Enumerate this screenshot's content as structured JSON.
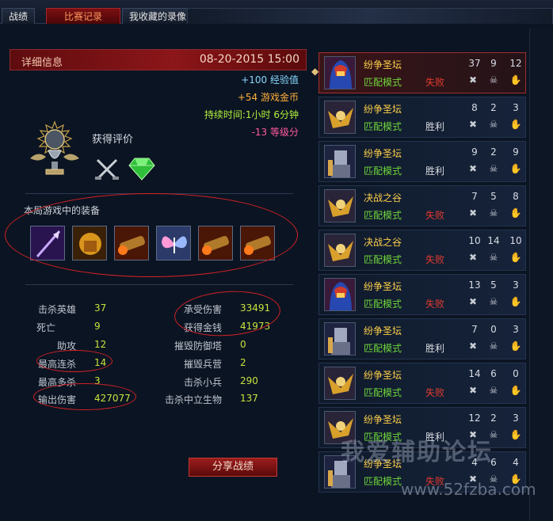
{
  "tabs": [
    {
      "label": "战绩",
      "active": false
    },
    {
      "label": "比赛记录",
      "active": true
    },
    {
      "label": "我收藏的录像",
      "active": false
    }
  ],
  "detail": {
    "title": "详细信息",
    "date": "08-20-2015 15:00",
    "exp": "+100 经验值",
    "gold": "+54 游戏金币",
    "duration": "持续时间:1小时 6分钟",
    "level_points": "-13 等级分",
    "rating_label": "获得评价",
    "equip_title": "本局游戏中的装备",
    "share_button": "分享战绩"
  },
  "stats_left": [
    {
      "label": "击杀英雄",
      "value": "37"
    },
    {
      "label": "死亡",
      "value": "9"
    },
    {
      "label": "助攻",
      "value": "12"
    },
    {
      "label": "最高连杀",
      "value": "14"
    },
    {
      "label": "最高多杀",
      "value": "3"
    },
    {
      "label": "输出伤害",
      "value": "427077"
    }
  ],
  "stats_right": [
    {
      "label": "承受伤害",
      "value": "33491"
    },
    {
      "label": "获得金钱",
      "value": "41973"
    },
    {
      "label": "摧毁防御塔",
      "value": "0"
    },
    {
      "label": "摧毁兵营",
      "value": "2"
    },
    {
      "label": "击杀小兵",
      "value": "290"
    },
    {
      "label": "击杀中立生物",
      "value": "137"
    }
  ],
  "items": [
    {
      "name": "purple-spear-item-icon"
    },
    {
      "name": "golden-helm-item-icon"
    },
    {
      "name": "fire-cannon-item-icon"
    },
    {
      "name": "butterfly-item-icon"
    },
    {
      "name": "fire-cannon-item-icon"
    },
    {
      "name": "fire-cannon-item-icon"
    }
  ],
  "matches": [
    {
      "map": "纷争圣坛",
      "mode": "匹配模式",
      "result": "失败",
      "win": false,
      "k": "37",
      "d": "9",
      "a": "12",
      "hero": "red-hood",
      "selected": true
    },
    {
      "map": "纷争圣坛",
      "mode": "匹配模式",
      "result": "胜利",
      "win": true,
      "k": "8",
      "d": "2",
      "a": "3",
      "hero": "gold-warrior",
      "selected": false
    },
    {
      "map": "纷争圣坛",
      "mode": "匹配模式",
      "result": "胜利",
      "win": true,
      "k": "9",
      "d": "2",
      "a": "9",
      "hero": "armored-knight",
      "selected": false
    },
    {
      "map": "决战之谷",
      "mode": "匹配模式",
      "result": "失败",
      "win": false,
      "k": "7",
      "d": "5",
      "a": "8",
      "hero": "gold-warrior",
      "selected": false
    },
    {
      "map": "决战之谷",
      "mode": "匹配模式",
      "result": "失败",
      "win": false,
      "k": "10",
      "d": "14",
      "a": "10",
      "hero": "gold-warrior",
      "selected": false
    },
    {
      "map": "纷争圣坛",
      "mode": "匹配模式",
      "result": "失败",
      "win": false,
      "k": "13",
      "d": "5",
      "a": "3",
      "hero": "red-hood",
      "selected": false
    },
    {
      "map": "纷争圣坛",
      "mode": "匹配模式",
      "result": "胜利",
      "win": true,
      "k": "7",
      "d": "0",
      "a": "3",
      "hero": "armored-knight",
      "selected": false
    },
    {
      "map": "纷争圣坛",
      "mode": "匹配模式",
      "result": "失败",
      "win": false,
      "k": "14",
      "d": "6",
      "a": "0",
      "hero": "gold-warrior",
      "selected": false
    },
    {
      "map": "纷争圣坛",
      "mode": "匹配模式",
      "result": "胜利",
      "win": true,
      "k": "12",
      "d": "2",
      "a": "3",
      "hero": "gold-warrior",
      "selected": false
    },
    {
      "map": "纷争圣坛",
      "mode": "匹配模式",
      "result": "失败",
      "win": false,
      "k": "4",
      "d": "6",
      "a": "4",
      "hero": "armored-knight",
      "selected": false
    }
  ],
  "watermark": {
    "text": "我爱辅助论坛",
    "url": "www.52fzba.com"
  },
  "colors": {
    "accent_red": "#8c1619",
    "win": "#d9dde3",
    "lose": "#e23a2e",
    "mode_green": "#6fd43a",
    "map_gold": "#ffd04a"
  }
}
